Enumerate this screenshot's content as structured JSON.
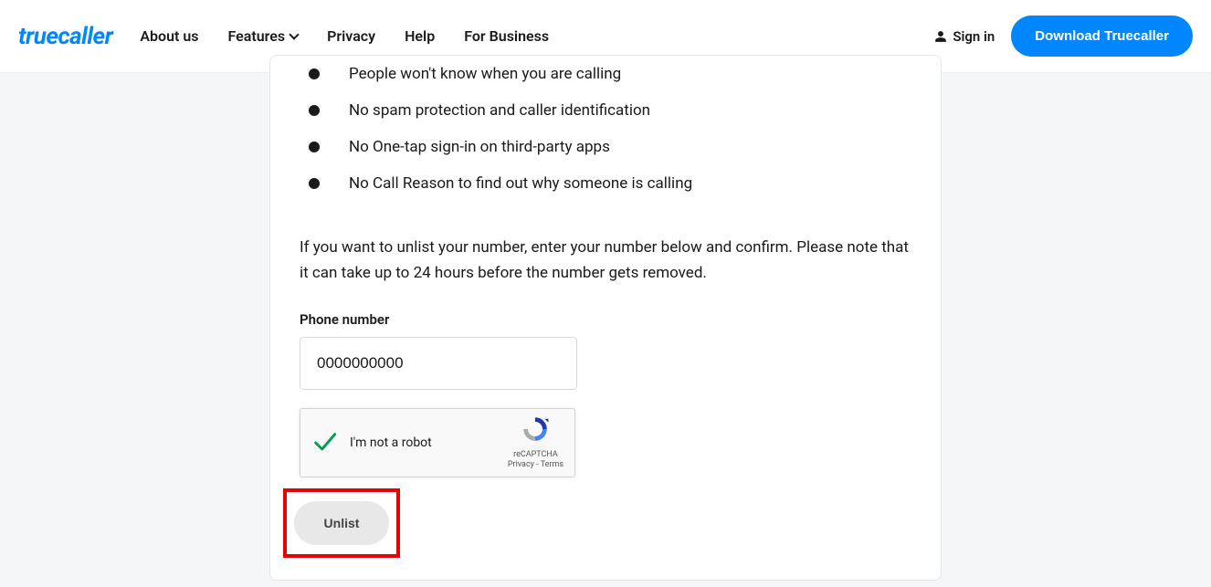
{
  "header": {
    "logo_text": "truecaller",
    "nav": [
      {
        "label": "About us",
        "has_dropdown": false
      },
      {
        "label": "Features",
        "has_dropdown": true
      },
      {
        "label": "Privacy",
        "has_dropdown": false
      },
      {
        "label": "Help",
        "has_dropdown": false
      },
      {
        "label": "For Business",
        "has_dropdown": false
      }
    ],
    "signin_label": "Sign in",
    "download_label": "Download Truecaller"
  },
  "card": {
    "bullets": [
      "People won't know when you are calling",
      "No spam protection and caller identification",
      "No One-tap sign-in on third-party apps",
      "No Call Reason to find out why someone is calling"
    ],
    "description": "If you want to unlist your number, enter your number below and confirm. Please note that it can take up to 24 hours before the number gets removed.",
    "phone_label": "Phone number",
    "phone_value": "0000000000",
    "recaptcha": {
      "label": "I'm not a robot",
      "brand": "reCAPTCHA",
      "privacy": "Privacy",
      "terms": "Terms"
    },
    "unlist_label": "Unlist"
  }
}
